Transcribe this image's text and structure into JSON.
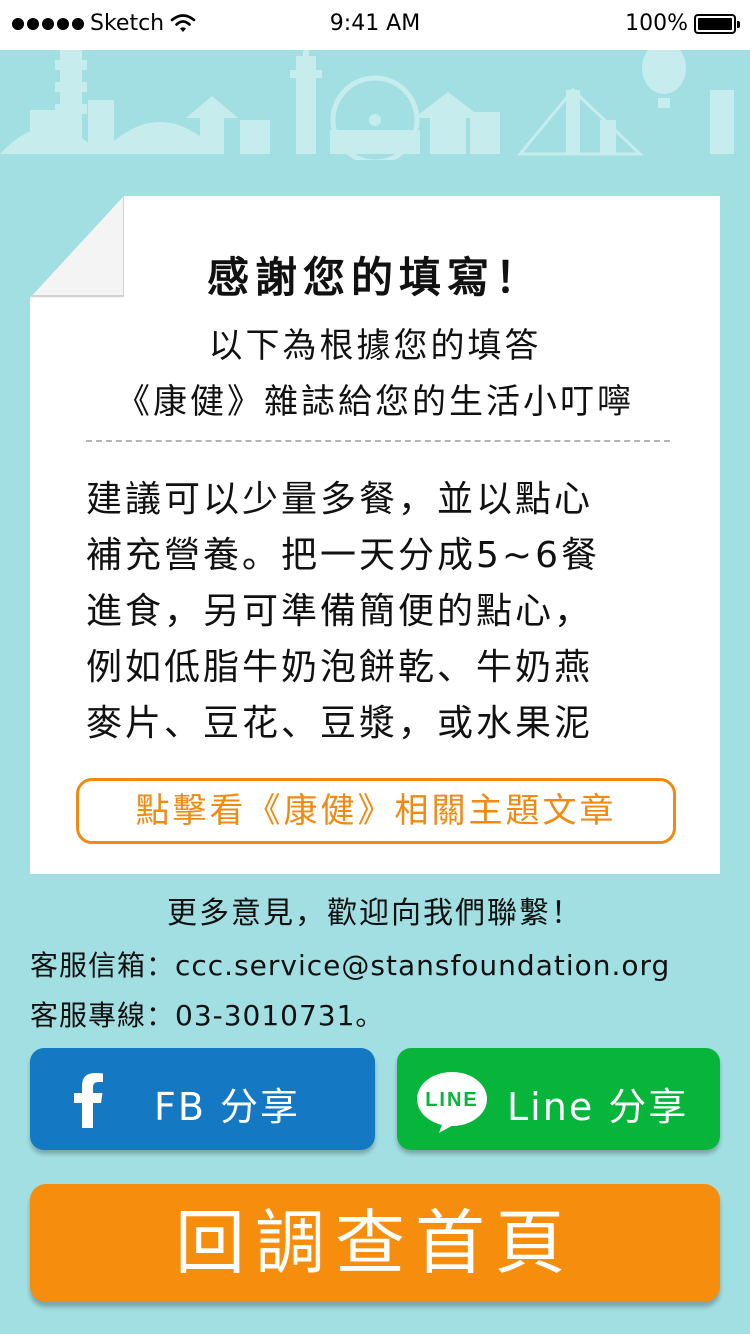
{
  "status_bar": {
    "carrier": "Sketch",
    "time": "9:41 AM",
    "battery": "100%",
    "battery_level": 1.0
  },
  "result": {
    "title": "感謝您的填寫！",
    "subtitle_line1": "以下為根據您的填答",
    "subtitle_line2": "《康健》雜誌給您的生活小叮嚀",
    "advice_lines": [
      "建議可以少量多餐，並以點心",
      "補充營養。把一天分成5~6餐",
      "進食，另可準備簡便的點心，",
      "例如低脂牛奶泡餅乾、牛奶燕",
      "麥片、豆花、豆漿，或水果泥"
    ],
    "article_button": "點擊看《康健》相關主題文章"
  },
  "contact": {
    "heading": "更多意見，歡迎向我們聯繫！",
    "email_line": "客服信箱：ccc.service@stansfoundation.org",
    "phone_line": "客服專線：03-3010731。"
  },
  "share": {
    "facebook_label": "FB 分享",
    "line_label": "Line 分享",
    "line_logo_text": "LINE"
  },
  "home_button": "回調查首頁",
  "colors": {
    "background": "#a2dfe3",
    "facebook": "#1478c3",
    "line": "#07b53b",
    "accent_orange": "#f68d0c"
  },
  "icons": {
    "signal": "signal-dots-icon",
    "wifi": "wifi-icon",
    "battery": "battery-icon",
    "facebook": "facebook-icon",
    "line": "line-icon"
  }
}
